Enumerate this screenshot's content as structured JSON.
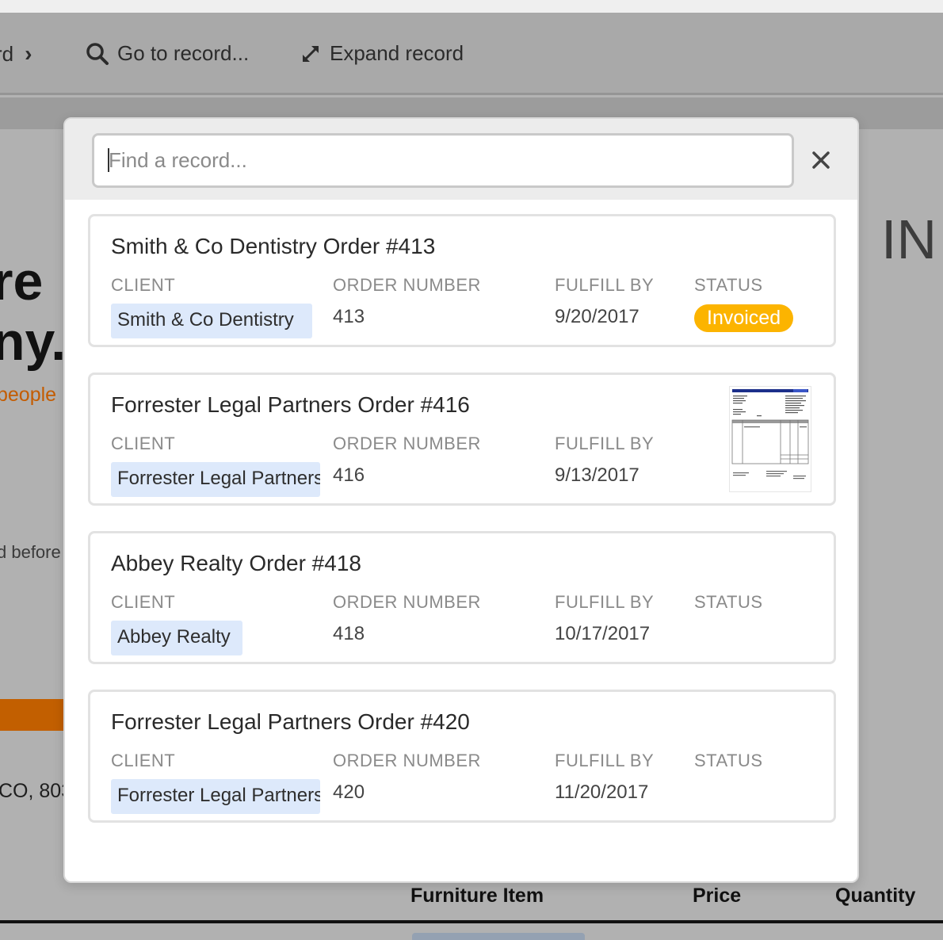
{
  "toolbar": {
    "prev_label": "rd",
    "goto_label": "Go to record...",
    "expand_label": "Expand record"
  },
  "background": {
    "big_text_1": "re",
    "big_text_2": "ny.",
    "orange_text": "people",
    "before_text": "d before",
    "address_text": "CO, 803",
    "heading_right": "IN",
    "col_furniture": "Furniture Item",
    "col_price": "Price",
    "col_quantity": "Quantity"
  },
  "search": {
    "placeholder": "Find a record..."
  },
  "records": [
    {
      "title": "Smith & Co Dentistry Order #413",
      "client_label": "CLIENT",
      "client": "Smith & Co Dentistry",
      "order_label": "ORDER NUMBER",
      "order_number": "413",
      "fulfill_label": "FULFILL BY",
      "fulfill_by": "9/20/2017",
      "status_label": "STATUS",
      "status": "Invoiced"
    },
    {
      "title": "Forrester Legal Partners Order #416",
      "client_label": "CLIENT",
      "client": "Forrester Legal Partners",
      "order_label": "ORDER NUMBER",
      "order_number": "416",
      "fulfill_label": "FULFILL BY",
      "fulfill_by": "9/13/2017"
    },
    {
      "title": "Abbey Realty Order #418",
      "client_label": "CLIENT",
      "client": "Abbey Realty",
      "order_label": "ORDER NUMBER",
      "order_number": "418",
      "fulfill_label": "FULFILL BY",
      "fulfill_by": "10/17/2017",
      "status_label": "STATUS"
    },
    {
      "title": "Forrester Legal Partners Order #420",
      "client_label": "CLIENT",
      "client": "Forrester Legal Partners",
      "order_label": "ORDER NUMBER",
      "order_number": "420",
      "fulfill_label": "FULFILL BY",
      "fulfill_by": "11/20/2017",
      "status_label": "STATUS"
    }
  ],
  "colors": {
    "status_invoiced": "#fcb400",
    "client_chip": "#dde9fb",
    "accent_orange": "#c45c00"
  }
}
